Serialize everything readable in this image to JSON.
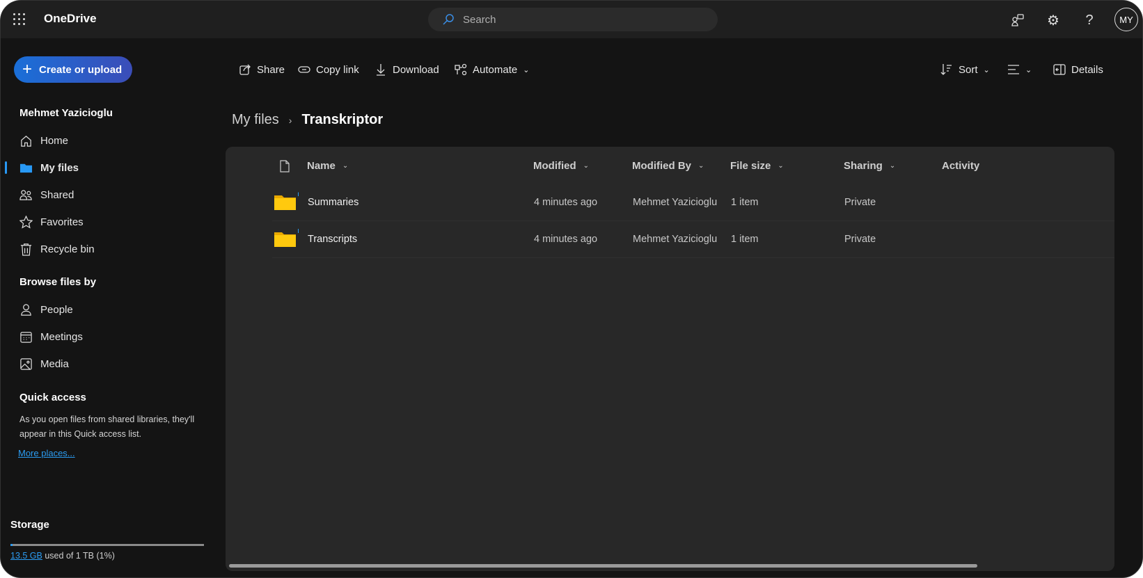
{
  "app": {
    "name": "OneDrive"
  },
  "search": {
    "placeholder": "Search"
  },
  "user": {
    "initials": "MY",
    "name": "Mehmet Yazicioglu"
  },
  "create_button": "Create or upload",
  "toolbar": {
    "share": "Share",
    "copy_link": "Copy link",
    "download": "Download",
    "automate": "Automate",
    "sort": "Sort",
    "details": "Details"
  },
  "sidebar": {
    "items": [
      {
        "label": "Home",
        "icon": "home-icon"
      },
      {
        "label": "My files",
        "icon": "folder-icon",
        "active": true
      },
      {
        "label": "Shared",
        "icon": "people-icon"
      },
      {
        "label": "Favorites",
        "icon": "star-icon"
      },
      {
        "label": "Recycle bin",
        "icon": "trash-icon"
      }
    ],
    "browse_heading": "Browse files by",
    "browse": [
      {
        "label": "People",
        "icon": "person-icon"
      },
      {
        "label": "Meetings",
        "icon": "calendar-icon"
      },
      {
        "label": "Media",
        "icon": "image-icon"
      }
    ],
    "quick_access": {
      "heading": "Quick access",
      "text": "As you open files from shared libraries, they'll appear in this Quick access list.",
      "link": "More places..."
    },
    "storage": {
      "heading": "Storage",
      "used": "13.5 GB",
      "rest": "used of 1 TB (1%)",
      "percent": 1
    }
  },
  "breadcrumb": {
    "parent": "My files",
    "current": "Transkriptor"
  },
  "table": {
    "headers": {
      "name": "Name",
      "modified": "Modified",
      "modified_by": "Modified By",
      "file_size": "File size",
      "sharing": "Sharing",
      "activity": "Activity"
    },
    "rows": [
      {
        "name": "Summaries",
        "modified": "4 minutes ago",
        "modified_by": "Mehmet Yazicioglu",
        "file_size": "1 item",
        "sharing": "Private"
      },
      {
        "name": "Transcripts",
        "modified": "4 minutes ago",
        "modified_by": "Mehmet Yazicioglu",
        "file_size": "1 item",
        "sharing": "Private"
      }
    ]
  }
}
